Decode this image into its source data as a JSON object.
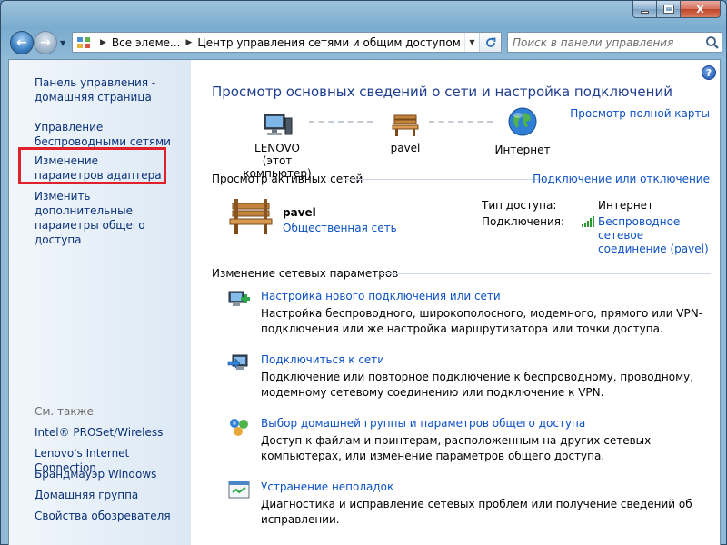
{
  "window": {
    "minimize_label": "",
    "maximize_label": "",
    "close_label": "X"
  },
  "address": {
    "crumbs": [
      "Все элеме...",
      "Центр управления сетями и общим доступом"
    ]
  },
  "search": {
    "placeholder": "Поиск в панели управления"
  },
  "sidebar": {
    "links": [
      "Панель управления - домашняя страница",
      "Управление беспроводными сетями",
      "Изменение параметров адаптера",
      "Изменить дополнительные параметры общего доступа"
    ],
    "see_also_title": "См. также",
    "see_also": [
      "Intel® PROSet/Wireless",
      "Lenovo's Internet Connection",
      "Брандмауэр Windows",
      "Домашняя группа",
      "Свойства обозревателя"
    ]
  },
  "main": {
    "help_label": "?",
    "heading": "Просмотр основных сведений о сети и настройка подключений",
    "full_map_link": "Просмотр полной карты",
    "map": {
      "computer_name": "LENOVO",
      "computer_sub": "(этот компьютер)",
      "network_name": "pavel",
      "internet_label": "Интернет"
    },
    "active_networks_title": "Просмотр активных сетей",
    "connect_disconnect_link": "Подключение или отключение",
    "active_network": {
      "name": "pavel",
      "type_link": "Общественная сеть",
      "access_type_label": "Тип доступа:",
      "access_type_value": "Интернет",
      "connections_label": "Подключения:",
      "connection_value_line1": "Беспроводное сетевое",
      "connection_value_line2": "соединение (pavel)"
    },
    "change_settings_title": "Изменение сетевых параметров",
    "tasks": [
      {
        "link": "Настройка нового подключения или сети",
        "desc": "Настройка беспроводного, широкополосного, модемного, прямого или VPN-подключения или же настройка маршрутизатора или точки доступа."
      },
      {
        "link": "Подключиться к сети",
        "desc": "Подключение или повторное подключение к беспроводному, проводному, модемному сетевому соединению или подключение к VPN."
      },
      {
        "link": "Выбор домашней группы и параметров общего доступа",
        "desc": "Доступ к файлам и принтерам, расположенным на других сетевых компьютерах, или изменение параметров общего доступа."
      },
      {
        "link": "Устранение неполадок",
        "desc": "Диагностика и исправление сетевых проблем или получение сведений об исправлении."
      }
    ]
  },
  "colors": {
    "link": "#0b51c5",
    "heading": "#1e3d8f",
    "highlight_box": "#e0202b"
  }
}
